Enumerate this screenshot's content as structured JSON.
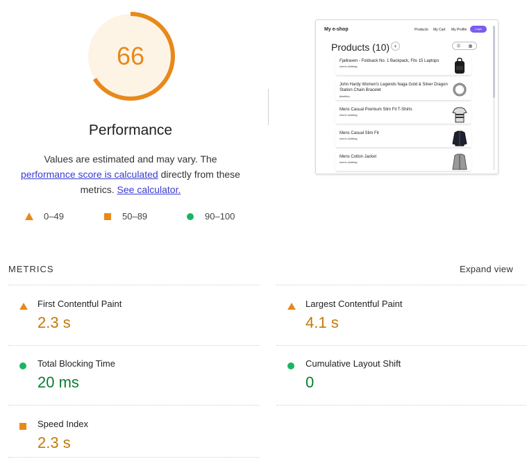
{
  "score": {
    "value": "66",
    "fraction": 0.66,
    "label": "Performance",
    "color": "#e8891a",
    "track_color": "#fdf4e6"
  },
  "description": {
    "text_1": "Values are estimated and may vary. The ",
    "link_1": "performance score is calculated",
    "text_2": " directly from these metrics. ",
    "link_2": "See calculator."
  },
  "legend": [
    {
      "icon": "triangle-icon",
      "range": "0–49"
    },
    {
      "icon": "square-icon",
      "range": "50–89"
    },
    {
      "icon": "circle-icon",
      "range": "90–100"
    }
  ],
  "thumbnail": {
    "brand": "My e-shop",
    "nav": [
      "Products",
      "My Cart",
      "My Profile"
    ],
    "login": "Login",
    "title": "Products (10)",
    "plus": "+",
    "view_icons": [
      "list-icon",
      "grid-icon"
    ],
    "products": [
      {
        "title": "Fjallraven - Foldsack No. 1 Backpack, Fits 15 Laptops",
        "category": "men's clothing",
        "image": "backpack-icon"
      },
      {
        "title": "John Hardy Women's Legends Naga Gold & Silver Dragon Station Chain Bracelet",
        "category": "jewelery",
        "image": "bracelet-icon"
      },
      {
        "title": "Mens Casual Premium Slim Fit T-Shirts",
        "category": "men's clothing",
        "image": "tshirt-icon"
      },
      {
        "title": "Mens Casual Slim Fit",
        "category": "men's clothing",
        "image": "shirt-icon"
      },
      {
        "title": "Mens Cotton Jacket",
        "category": "men's clothing",
        "image": "jacket-icon"
      }
    ]
  },
  "metrics_section": {
    "heading": "METRICS",
    "expand_label": "Expand view",
    "items": [
      {
        "name": "First Contentful Paint",
        "value": "2.3 s",
        "rating": "average",
        "icon": "triangle-icon"
      },
      {
        "name": "Largest Contentful Paint",
        "value": "4.1 s",
        "rating": "average",
        "icon": "triangle-icon"
      },
      {
        "name": "Total Blocking Time",
        "value": "20 ms",
        "rating": "pass",
        "icon": "circle-icon"
      },
      {
        "name": "Cumulative Layout Shift",
        "value": "0",
        "rating": "pass",
        "icon": "circle-icon"
      },
      {
        "name": "Speed Index",
        "value": "2.3 s",
        "rating": "average",
        "icon": "square-icon"
      }
    ]
  },
  "colors": {
    "average": "#e8891a",
    "pass": "#18b663",
    "link": "#3a3acf"
  }
}
